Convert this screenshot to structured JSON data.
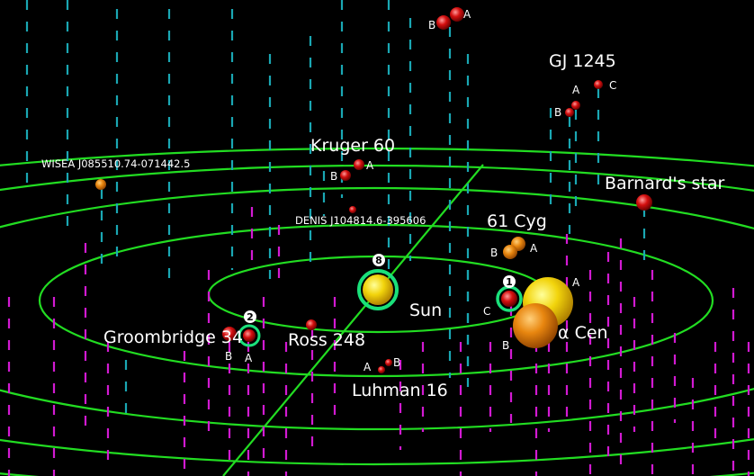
{
  "colors": {
    "background": "#000000",
    "orbit_rings": "#22dd22",
    "stem_above": "#1aa7b3",
    "stem_below": "#d21ad2",
    "marker_ring": "#1ae07a"
  },
  "stars": {
    "sun": "Sun",
    "alpha_cen": "α Cen",
    "alpha_cen_a": "A",
    "alpha_cen_b": "B",
    "alpha_cen_c": "C",
    "barnards_star": "Barnard's star",
    "cyg61": "61 Cyg",
    "cyg61_a": "A",
    "cyg61_b": "B",
    "gj1245": "GJ 1245",
    "gj1245_a": "A",
    "gj1245_b": "B",
    "gj1245_c": "C",
    "kruger60": "Kruger 60",
    "kruger60_a": "A",
    "kruger60_b": "B",
    "top_pair_a": "A",
    "top_pair_b": "B",
    "wisea": "WISEA J085510.74-071442.5",
    "denis": "DENIS J104814.6-395606",
    "ross248": "Ross 248",
    "groombridge34": "Groombridge 34",
    "groombridge34_a": "A",
    "groombridge34_b": "B",
    "luhman16": "Luhman 16",
    "luhman16_a": "A",
    "luhman16_b": "B"
  },
  "markers": {
    "sun_count": "8",
    "alpha_cen_count": "1",
    "groombridge_count": "2"
  }
}
